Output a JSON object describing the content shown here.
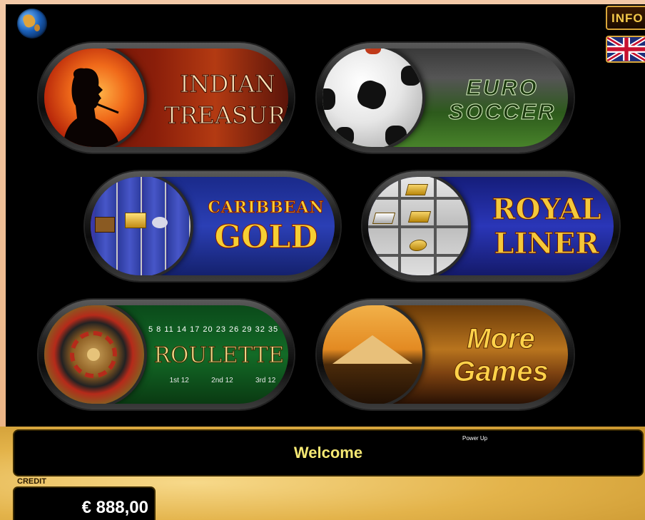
{
  "header": {
    "info_label": "INFO",
    "language_icon": "uk-flag-icon",
    "globe_icon": "globe-icon"
  },
  "games": [
    {
      "lines": [
        "INDIAN",
        "TREASURE"
      ]
    },
    {
      "lines": [
        "EURO",
        "SOCCER"
      ]
    },
    {
      "lines": [
        "CARIBBEAN",
        "GOLD"
      ]
    },
    {
      "lines": [
        "ROYAL",
        "LINER"
      ]
    },
    {
      "lines": [
        "ROULETTE"
      ],
      "numbers": "5  8  11 14 17 20 23 26 29 32 35",
      "dozens": [
        "1st 12",
        "2nd 12",
        "3rd 12"
      ]
    },
    {
      "lines": [
        "More",
        "Games"
      ]
    }
  ],
  "status": {
    "power_label": "Power Up",
    "message": "Welcome"
  },
  "credit": {
    "label": "CREDIT",
    "value": "€ 888,00"
  },
  "colors": {
    "accent_gold": "#f4c94a",
    "message_text": "#f5e873"
  }
}
